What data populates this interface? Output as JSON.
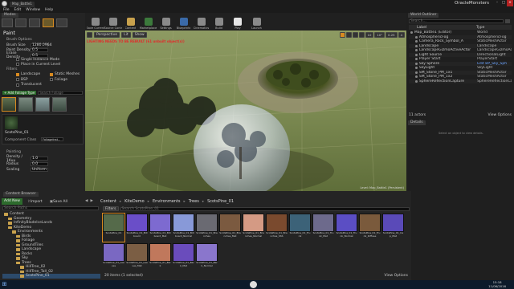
{
  "title_bar": {
    "window_title": "OracleMonsters",
    "app_tab": "Map_Battle1"
  },
  "menu": [
    "File",
    "Edit",
    "Window",
    "Help"
  ],
  "modes_tab": "Modes",
  "paint": {
    "title": "Paint",
    "section_brush": "Brush Options",
    "fields": [
      {
        "label": "Brush Size",
        "value": "1280.0964"
      },
      {
        "label": "Paint Density",
        "value": "0.5"
      },
      {
        "label": "Erase Density",
        "value": "0.5"
      }
    ],
    "checks": [
      {
        "label": "Single Instance Mode",
        "on": false
      },
      {
        "label": "Place in Current Level",
        "on": false
      }
    ],
    "section_filters": "Filters",
    "filters": [
      {
        "label": "Landscape",
        "on": true
      },
      {
        "label": "Static Meshes",
        "on": true
      },
      {
        "label": "BSP",
        "on": false
      },
      {
        "label": "Foliage",
        "on": false
      },
      {
        "label": "Translucent",
        "on": false
      }
    ],
    "add_foliage_type": "Add Foliage Type",
    "search_placeholder": "Search Foliage",
    "selected_asset": "ScotsPine_01",
    "component_label": "Component Class",
    "component_value": "FoliageInst...",
    "section_painting": "Painting",
    "painting_fields": [
      {
        "label": "Density / 1Kuu",
        "value": "1.0"
      },
      {
        "label": "Radius",
        "value": "0.0"
      },
      {
        "label": "Scaling",
        "value": "Uniform"
      }
    ]
  },
  "toolbar": {
    "buttons": [
      "Save Current",
      "Source Control",
      "Content",
      "Marketplace",
      "Settings",
      "Blueprints",
      "Cinematics",
      "Build",
      "Play",
      "Launch"
    ]
  },
  "viewport": {
    "perspective": "Perspective",
    "lit": "Lit",
    "show": "Show",
    "warning": "LIGHTING NEEDS TO BE REBUILT (61 unbuilt object(s))",
    "snap_values": [
      "10",
      "10°",
      "0.25",
      "4"
    ],
    "level_label": "Level: Map_Battle1 (Persistent)"
  },
  "outliner": {
    "tab": "World Outliner",
    "search_placeholder": "Search...",
    "col_label": "Label",
    "col_type": "Type",
    "items": [
      {
        "label": "Map_Battle1 (Editor)",
        "type": "World"
      },
      {
        "label": "AtmosphericFog",
        "type": "AtmosphericFog"
      },
      {
        "label": "Camera_Rock_Symbol_A",
        "type": "StaticMeshActor"
      },
      {
        "label": "Landscape",
        "type": "Landscape"
      },
      {
        "label": "LandscapeGizmoActiveActor",
        "type": "LandscapeGizmoActor"
      },
      {
        "label": "Light Source",
        "type": "DirectionalLight"
      },
      {
        "label": "Player Start",
        "type": "PlayerStart"
      },
      {
        "label": "Sky Sphere",
        "type": "Edit BP_Sky_Sph"
      },
      {
        "label": "SkyLight",
        "type": "SkyLight"
      },
      {
        "label": "SM_Stone_PM_1x1",
        "type": "StaticMeshActor"
      },
      {
        "label": "SM_Stone_PM_1x2",
        "type": "StaticMeshActor"
      },
      {
        "label": "SphereReflectionCapture",
        "type": "SphereReflectionCa"
      }
    ],
    "count": "11 actors",
    "view_options": "View Options"
  },
  "details": {
    "tab": "Details",
    "empty": "Select an object to view details."
  },
  "content_browser": {
    "tab": "Content Browser",
    "add_new": "Add New",
    "import": "Import",
    "save_all": "Save All",
    "path": [
      "Content",
      "KiteDemo",
      "Environments",
      "Trees",
      "ScotsPine_01"
    ],
    "search_paths": "Search Paths",
    "filters": "Filters",
    "search_placeholder": "Search ScotsPine_01",
    "tree": [
      {
        "label": "Content",
        "depth": 0
      },
      {
        "label": "Geometry",
        "depth": 1
      },
      {
        "label": "InfinityBladeIceLands",
        "depth": 1
      },
      {
        "label": "KiteDemo",
        "depth": 1
      },
      {
        "label": "Environments",
        "depth": 2
      },
      {
        "label": "Birds",
        "depth": 3
      },
      {
        "label": "Foliage",
        "depth": 3
      },
      {
        "label": "GroundTiles",
        "depth": 3
      },
      {
        "label": "Landscape",
        "depth": 3
      },
      {
        "label": "Rocks",
        "depth": 3
      },
      {
        "label": "Sky",
        "depth": 3
      },
      {
        "label": "Trees",
        "depth": 3
      },
      {
        "label": "HillTree_02",
        "depth": 4
      },
      {
        "label": "HillTree_Tall_02",
        "depth": 4
      },
      {
        "label": "ScotsPine_01",
        "depth": 4
      }
    ],
    "assets": [
      {
        "name": "ScotsPine_01",
        "color": "#556a4a"
      },
      {
        "name": "ScotsPine_01_Billboard",
        "color": "#6a4ec8"
      },
      {
        "name": "ScotsPine_01_Billboard_Mat",
        "color": "#7d6ad0"
      },
      {
        "name": "ScotsPine_01_Billboard_Normal",
        "color": "#8899d8"
      },
      {
        "name": "ScotsPine_01_Branches",
        "color": "#6a6a72"
      },
      {
        "name": "ScotsPine_01_Branches_Mat",
        "color": "#7b5a40"
      },
      {
        "name": "ScotsPine_01_Branches_Normal",
        "color": "#d49a84"
      },
      {
        "name": "ScotsPine_01_Branches_SSS",
        "color": "#7a4a2e"
      },
      {
        "name": "ScotsPine_01_Trunk",
        "color": "#3c6278"
      },
      {
        "name": "ScotsPine_01_Trunk_Mat",
        "color": "#6d6a8c"
      },
      {
        "name": "ScotsPine_01_Trunk_Normal",
        "color": "#5b4ec4"
      },
      {
        "name": "ScotsPine_01_Trunk_Diffuse",
        "color": "#7a5a3c"
      },
      {
        "name": "ScotsPine_01_Cap_Mat",
        "color": "#5a4ab8"
      },
      {
        "name": "ScotsPine_01_Leaves",
        "color": "#7a68c2"
      },
      {
        "name": "ScotsPine_01_Leaves_Mat",
        "color": "#7b5e44"
      },
      {
        "name": "ScotsPine_01_Bark",
        "color": "#c0785c"
      },
      {
        "name": "ScotsPine_01_Bark_Mat",
        "color": "#6a4cbc"
      },
      {
        "name": "ScotsPine_01_Bark_Normal",
        "color": "#8a76cc"
      }
    ],
    "status": "20 items (1 selected)",
    "view_options": "View Options"
  },
  "taskbar": {
    "time": "15:18",
    "date": "11/06/2016"
  }
}
